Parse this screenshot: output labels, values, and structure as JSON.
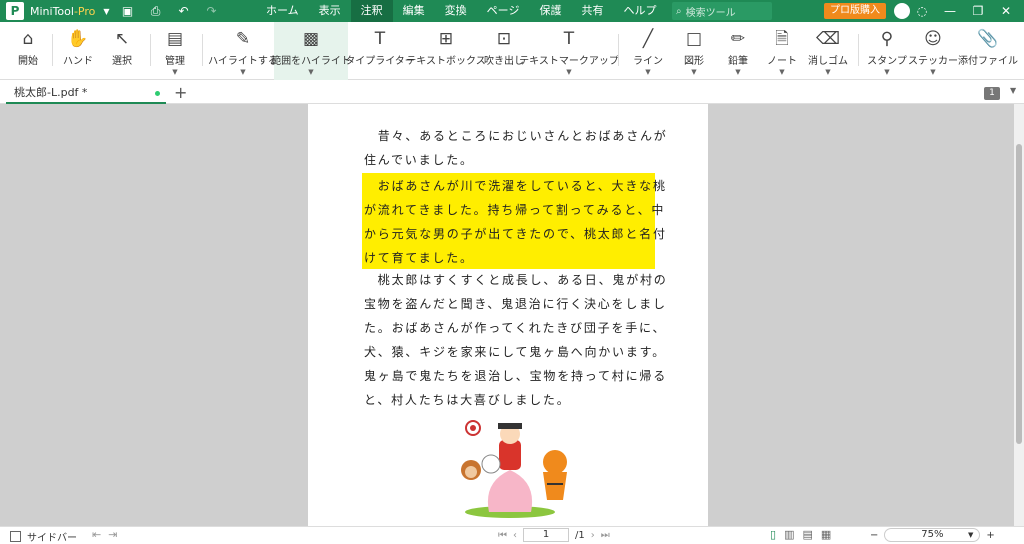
{
  "titlebar": {
    "app_name": "MiniTool",
    "app_suffix": "-Pro",
    "menus": [
      "ホーム",
      "表示",
      "注釈",
      "編集",
      "変換",
      "ページ",
      "保護",
      "共有",
      "ヘルプ"
    ],
    "active_menu": "注釈",
    "search_placeholder": "検索ツール",
    "pro_button": "プロ版購入"
  },
  "toolbar": {
    "tools": [
      {
        "label": "開始",
        "icon": "home-icon"
      },
      {
        "label": "ハンド",
        "icon": "hand-icon"
      },
      {
        "label": "選択",
        "icon": "cursor-icon"
      },
      {
        "label": "管理",
        "icon": "manage-icon"
      },
      {
        "label": "ハイライトする",
        "icon": "highlighter-icon"
      },
      {
        "label": "範囲をハイライト",
        "icon": "area-highlight-icon"
      },
      {
        "label": "タイプライター",
        "icon": "typewriter-icon"
      },
      {
        "label": "テキストボックス",
        "icon": "textbox-icon"
      },
      {
        "label": "吹き出し",
        "icon": "callout-icon"
      },
      {
        "label": "テキストマークアップ",
        "icon": "text-markup-icon"
      },
      {
        "label": "ライン",
        "icon": "line-icon"
      },
      {
        "label": "図形",
        "icon": "shape-icon"
      },
      {
        "label": "鉛筆",
        "icon": "pencil-icon"
      },
      {
        "label": "ノート",
        "icon": "note-icon"
      },
      {
        "label": "消しゴム",
        "icon": "eraser-icon"
      },
      {
        "label": "スタンプ",
        "icon": "stamp-icon"
      },
      {
        "label": "ステッカー",
        "icon": "sticker-icon"
      },
      {
        "label": "添付ファイル",
        "icon": "attachment-icon"
      }
    ]
  },
  "tabs": {
    "active_tab": "桃太郎-L.pdf *",
    "page_badge": "1"
  },
  "document": {
    "para1": [
      "　昔々、あるところにおじいさんとおばあさんが",
      "住んでいました。"
    ],
    "para2": [
      "　おばあさんが川で洗濯をしていると、大きな桃",
      "が流れてきました。持ち帰って割ってみると、中",
      "から元気な男の子が出てきたので、桃太郎と名付",
      "けて育てました。"
    ],
    "para3": [
      "　桃太郎はすくすくと成長し、ある日、鬼が村の",
      "宝物を盗んだと聞き、鬼退治に行く決心をしまし",
      "た。おばあさんが作ってくれたきび団子を手に、",
      "犬、猿、キジを家来にして鬼ヶ島へ向かいます。",
      "鬼ヶ島で鬼たちを退治し、宝物を持って村に帰る",
      "と、村人たちは大喜びしました。"
    ],
    "highlight_color": "#ffee00"
  },
  "statusbar": {
    "sidebar_label": "サイドバー",
    "current_page": "1",
    "total_pages": "/1",
    "zoom": "75%"
  }
}
